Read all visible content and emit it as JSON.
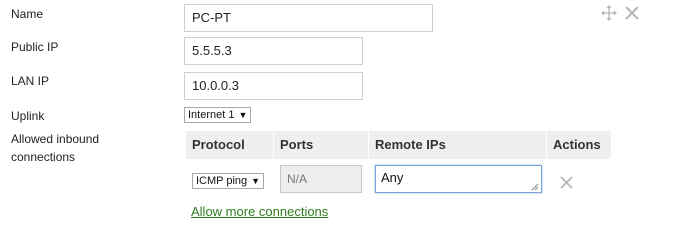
{
  "form": {
    "name_label": "Name",
    "name_value": "PC-PT",
    "public_ip_label": "Public IP",
    "public_ip_value": "5.5.5.3",
    "lan_ip_label": "LAN IP",
    "lan_ip_value": "10.0.0.3",
    "uplink_label": "Uplink",
    "uplink_value": "Internet 1",
    "inbound_label_line1": "Allowed inbound",
    "inbound_label_line2": "connections"
  },
  "window_icons": {
    "move": "move-icon",
    "close": "close-icon"
  },
  "table": {
    "headers": [
      "Protocol",
      "Ports",
      "Remote IPs",
      "Actions"
    ],
    "rows": [
      {
        "protocol": "ICMP ping",
        "ports": "N/A",
        "remote_ips": "Any",
        "remove_icon": "close-icon"
      }
    ],
    "add_link": "Allow more connections"
  },
  "colors": {
    "link": "#2e7d1f",
    "header_bg": "#efefef",
    "icon_gray": "#b5b5b5"
  }
}
